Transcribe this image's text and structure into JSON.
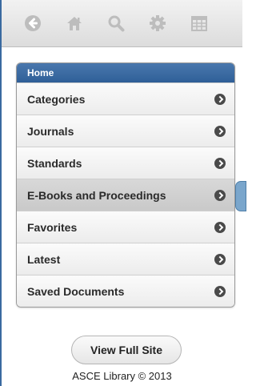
{
  "toolbar": {
    "icons": [
      "back-icon",
      "home-icon",
      "search-icon",
      "settings-icon",
      "calendar-icon"
    ]
  },
  "menu": {
    "header": "Home",
    "items": [
      {
        "label": "Categories"
      },
      {
        "label": "Journals"
      },
      {
        "label": "Standards"
      },
      {
        "label": "E-Books and Proceedings"
      },
      {
        "label": "Favorites"
      },
      {
        "label": "Latest"
      },
      {
        "label": "Saved Documents"
      }
    ]
  },
  "footer": {
    "full_site_button": "View Full Site",
    "copyright": "ASCE Library © 2013"
  },
  "colors": {
    "accent": "#2f5f98",
    "toolbar_bg": "#e8e8e8",
    "item_bg": "#f1f1f1",
    "active_item_bg": "#d0d0d0"
  }
}
